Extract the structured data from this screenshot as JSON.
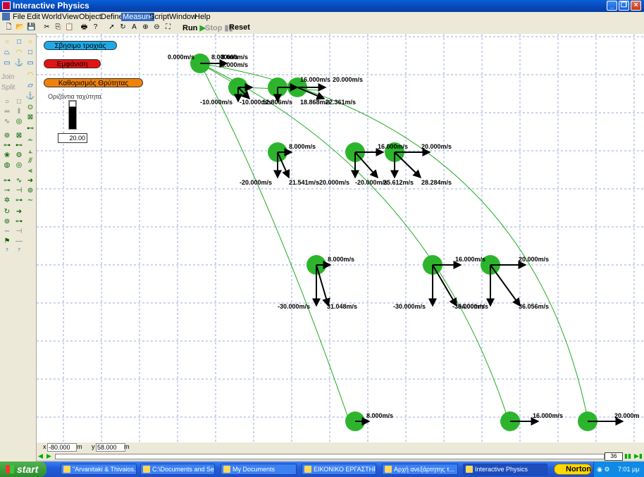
{
  "window": {
    "title": "Interactive Physics"
  },
  "menu": [
    "File",
    "Edit",
    "World",
    "View",
    "Object",
    "Define",
    "Measure",
    "Script",
    "Window",
    "Help"
  ],
  "toolbar": {
    "run": "Run",
    "stop": "Stop",
    "reset": "Reset"
  },
  "leftbar": {
    "join": "Join",
    "split": "Split"
  },
  "controls": {
    "btn_erase": "Σβησιμο τροχιάς",
    "btn_show": "Εμφάνιση",
    "btn_set_speed": "Καθορισμός Θρύτητας",
    "slider_label": "Οριζόντια ταχύτητα",
    "slider_value": "20.00",
    "slider_level": 0.1,
    "colors": {
      "erase": "#1fa9e6",
      "show": "#e01414",
      "set": "#f0820a"
    }
  },
  "labels": [
    "0.000m/s",
    "8.000m/s",
    "8.000m/s",
    "8.000m/s",
    "-10.000m/s",
    "-10.000m/s",
    "12.806m/s",
    "16.000m/s",
    "20.000m/s",
    "18.868m/s",
    "22.361m/s",
    "8.000m/s",
    "16.000m/s",
    "20.000m/s",
    "-20.000m/s",
    "21.541m/s",
    "-20.000m/s",
    "-20.000m/s",
    "25.612m/s",
    "28.284m/s",
    "8.000m/s",
    "16.000m/s",
    "20.000m/s",
    "-30.000m/s",
    "31.048m/s",
    "-30.000m/s",
    "-30.000m/s",
    "34.000m/s",
    "36.056m/s",
    "8.000m/s",
    "16.000m/s",
    "20.000m"
  ],
  "coords": {
    "x_label": "x",
    "x_value": "-80.000",
    "x_unit": "m",
    "y_label": "y",
    "y_value": "58.000",
    "y_unit": "m"
  },
  "frame": "36",
  "taskbar": {
    "start": "start",
    "tasks": [
      "\"Arvanitaki & Thivaios...",
      "C:\\Documents and Se...",
      "My Documents",
      "ΕΙΚΟΝΙΚΟ ΕΡΓΑΣΤΗΡΙ...",
      "Αρχή ανεξάρτητης τ...",
      "Interactive Physics"
    ],
    "norton": "Norton",
    "clock": "7:01 μμ"
  }
}
